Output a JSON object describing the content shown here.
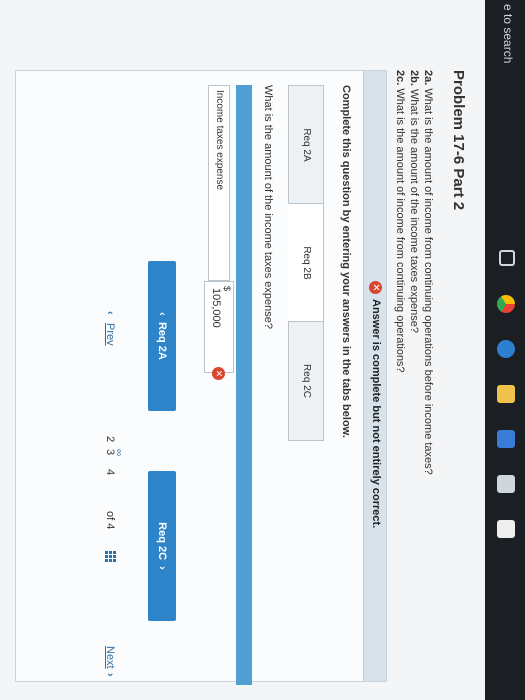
{
  "taskbar": {
    "search_fragment": "e to search"
  },
  "problem": {
    "title": "Problem 17-6 Part 2",
    "questions": [
      {
        "num": "2a.",
        "text": "What is the amount of income from continuing operations before income taxes?"
      },
      {
        "num": "2b.",
        "text": "What is the amount of the income taxes expense?"
      },
      {
        "num": "2c.",
        "text": "What is the amount of income from continuing operations?"
      }
    ]
  },
  "answer": {
    "status": "Answer is complete but not entirely correct.",
    "instruction": "Complete this question by entering your answers in the tabs below.",
    "tabs": [
      {
        "label": "Req 2A"
      },
      {
        "label": "Req 2B"
      },
      {
        "label": "Req 2C"
      }
    ],
    "active_tab": "Req 2B",
    "tab_question": "What is the amount of the income taxes expense?",
    "row_label": "Income taxes expense",
    "currency": "$",
    "value": "105,000"
  },
  "nav": {
    "prev_req": "Req 2A",
    "next_req": "Req 2C"
  },
  "pager": {
    "prev": "Prev",
    "pages": [
      "2",
      "3",
      "4"
    ],
    "of_text": "of 4",
    "next": "Next"
  },
  "colors": {
    "button": "#2d84c9",
    "error": "#d9452f",
    "link": "#2d6fa8"
  }
}
